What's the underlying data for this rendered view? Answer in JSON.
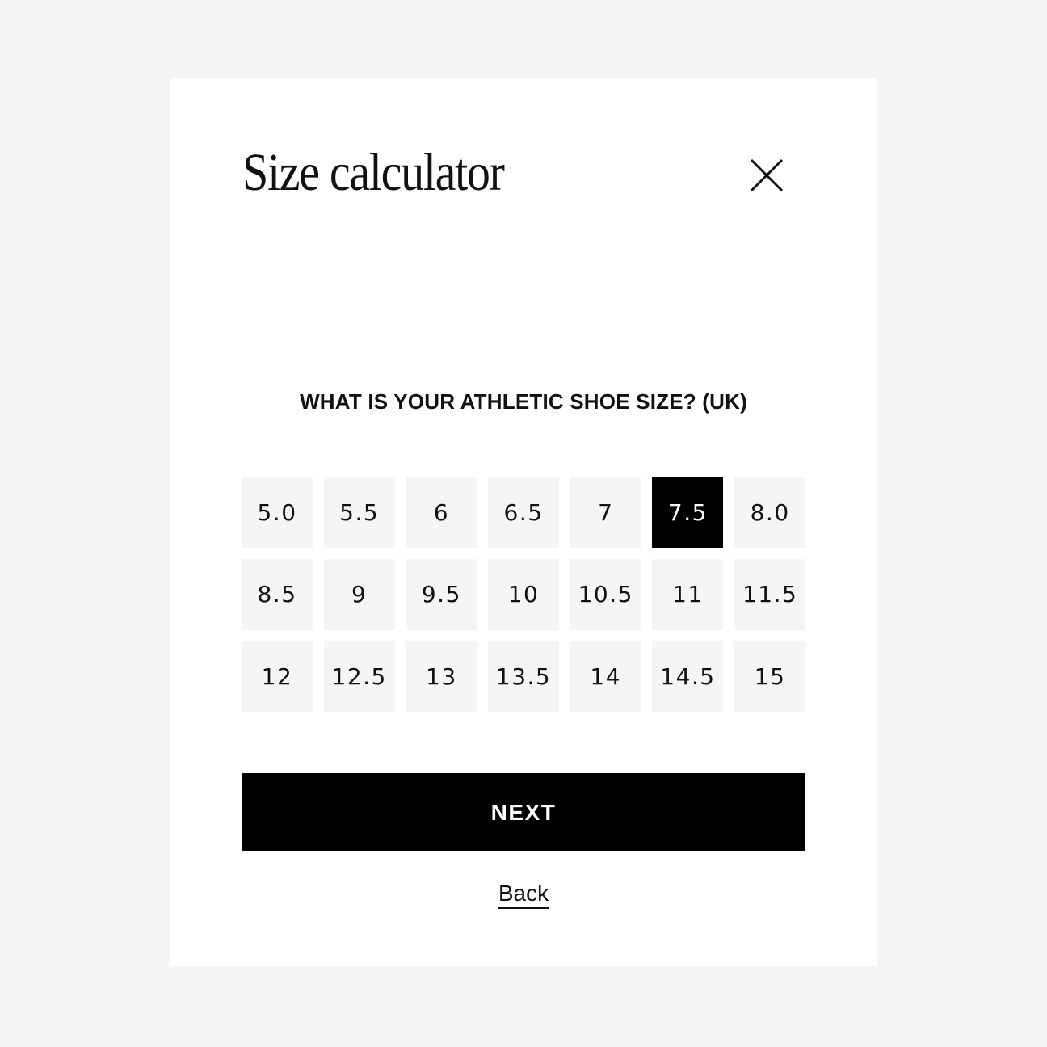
{
  "modal": {
    "title": "Size calculator",
    "close_icon": "close-icon",
    "question": "WHAT IS YOUR ATHLETIC SHOE SIZE? (UK)",
    "sizes": [
      "5.0",
      "5.5",
      "6",
      "6.5",
      "7",
      "7.5",
      "8.0",
      "8.5",
      "9",
      "9.5",
      "10",
      "10.5",
      "11",
      "11.5",
      "12",
      "12.5",
      "13",
      "13.5",
      "14",
      "14.5",
      "15"
    ],
    "selected_size": "7.5",
    "next_label": "NEXT",
    "back_label": "Back"
  },
  "colors": {
    "page_background": "#f5f5f5",
    "modal_background": "#ffffff",
    "option_background": "#f5f5f5",
    "selected_background": "#000000",
    "selected_text": "#ffffff",
    "primary_button": "#000000",
    "text": "#111111"
  }
}
